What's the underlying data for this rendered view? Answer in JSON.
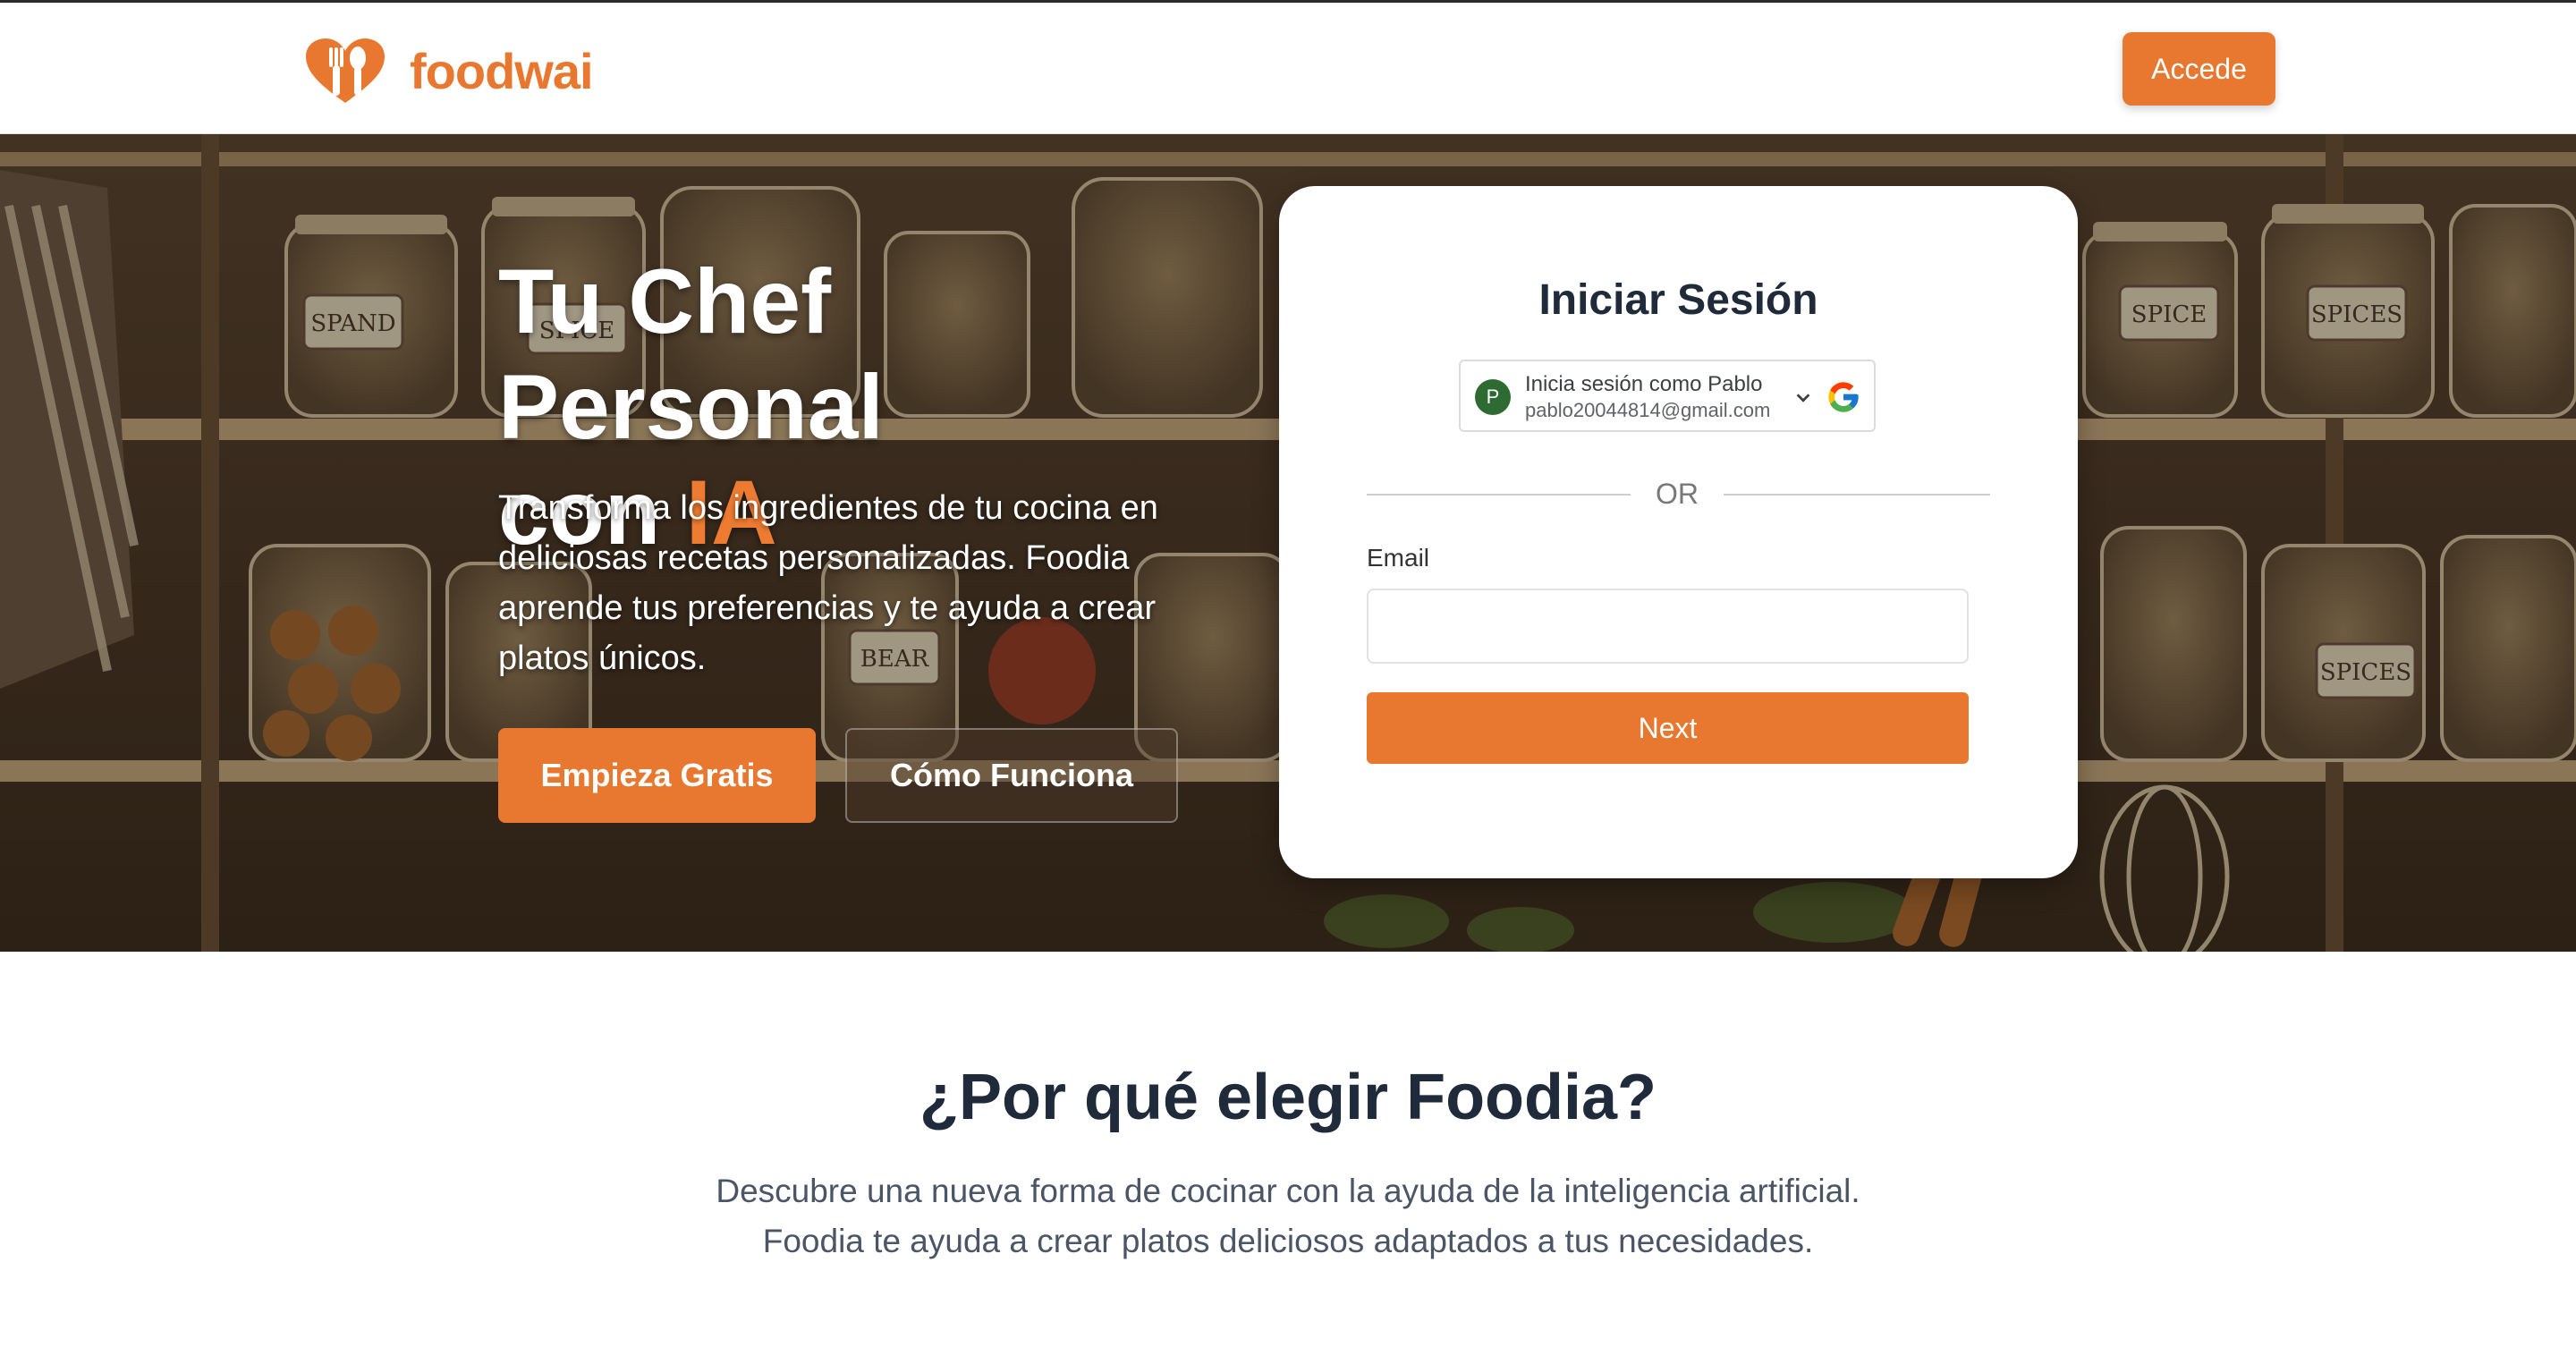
{
  "nav": {
    "logo_text": "foodwai",
    "accede_label": "Accede"
  },
  "hero": {
    "title_main": "Tu Chef Personal",
    "title_con": "con ",
    "title_accent": "IA",
    "description": "Transforma los ingredientes de tu cocina en deliciosas recetas personalizadas. Foodia aprende tus preferencias y te ayuda a crear platos únicos.",
    "cta_primary": "Empieza Gratis",
    "cta_secondary": "Cómo Funciona",
    "jar_labels": [
      "SPAND",
      "SPICE",
      "BEAR",
      "SPICE",
      "SPICES",
      "SPICES"
    ]
  },
  "login": {
    "title": "Iniciar Sesión",
    "google": {
      "avatar_letter": "P",
      "line1": "Inicia sesión como Pablo",
      "line2": "pablo20044814@gmail.com"
    },
    "or_text": "OR",
    "email_label": "Email",
    "email_value": "",
    "next_label": "Next"
  },
  "why": {
    "title": "¿Por qué elegir Foodia?",
    "line1": "Descubre una nueva forma de cocinar con la ayuda de la inteligencia artificial.",
    "line2": "Foodia te ayuda a crear platos deliciosos adaptados a tus necesidades."
  },
  "colors": {
    "brand": "#e8782f",
    "heading": "#1f2a3a"
  }
}
